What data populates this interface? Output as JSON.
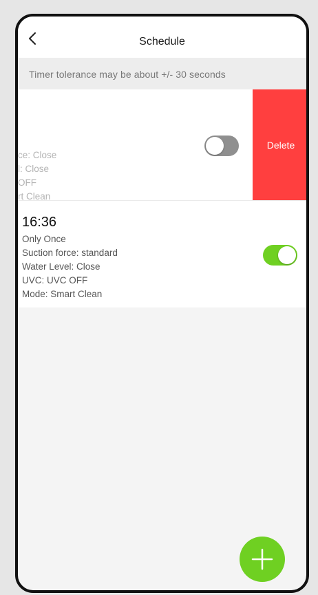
{
  "header": {
    "title": "Schedule"
  },
  "notice": "Timer tolerance may be about +/- 30 seconds",
  "schedules": [
    {
      "time": "",
      "frequency": "",
      "suction": "",
      "water_clipped": "ce: Close",
      "uvc_clipped": "l: Close",
      "mode_clipped": "OFF",
      "extra_clipped": "rt Clean",
      "enabled": false,
      "swipe_action": "Delete"
    },
    {
      "time": "16:36",
      "frequency": "Only Once",
      "suction": "Suction force: standard",
      "water": "Water Level: Close",
      "uvc": "UVC: UVC OFF",
      "mode": "Mode: Smart Clean",
      "enabled": true
    }
  ],
  "colors": {
    "accent": "#6fd022",
    "delete": "#ff3f3f"
  }
}
